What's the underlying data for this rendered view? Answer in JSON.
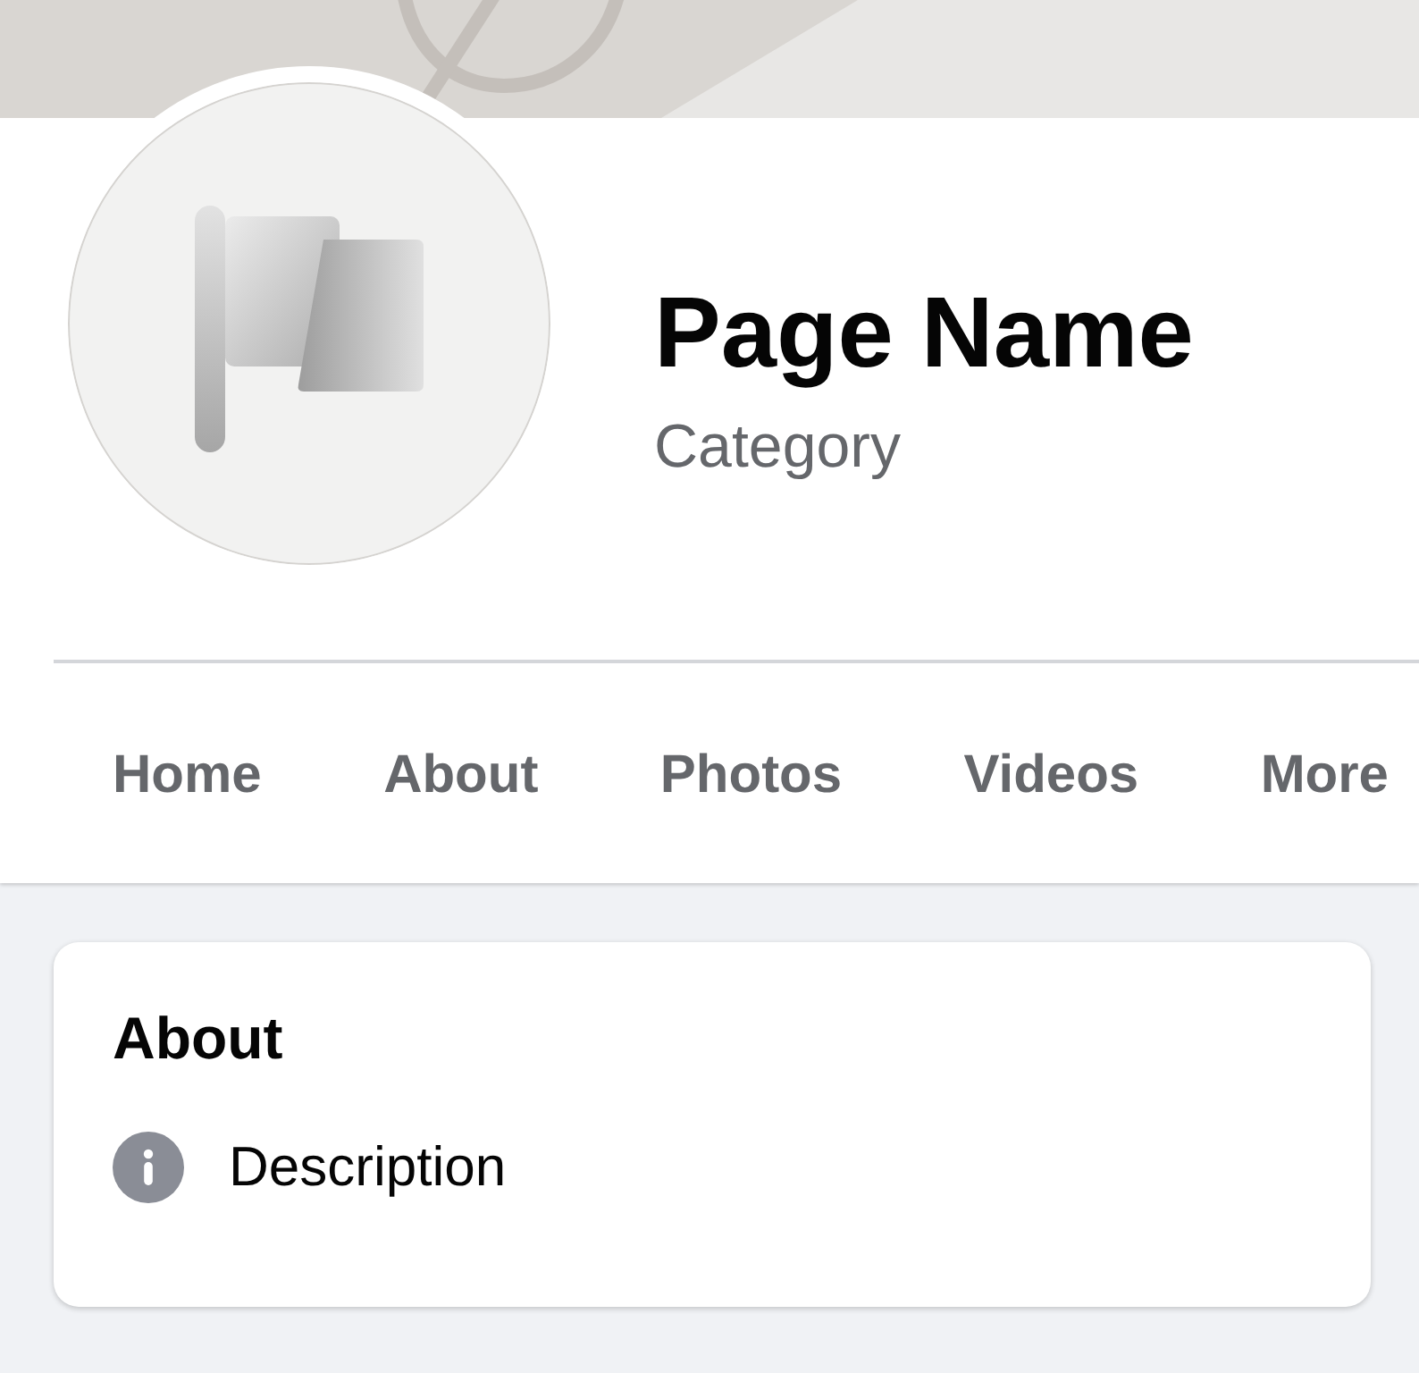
{
  "profile": {
    "name": "Page Name",
    "category": "Category"
  },
  "tabs": [
    {
      "label": "Home",
      "selected": false
    },
    {
      "label": "About",
      "selected": false
    },
    {
      "label": "Photos",
      "selected": false
    },
    {
      "label": "Videos",
      "selected": false
    },
    {
      "label": "More",
      "selected": false
    }
  ],
  "about_card": {
    "title": "About",
    "items": [
      {
        "kind": "info",
        "text": "Description"
      }
    ]
  }
}
